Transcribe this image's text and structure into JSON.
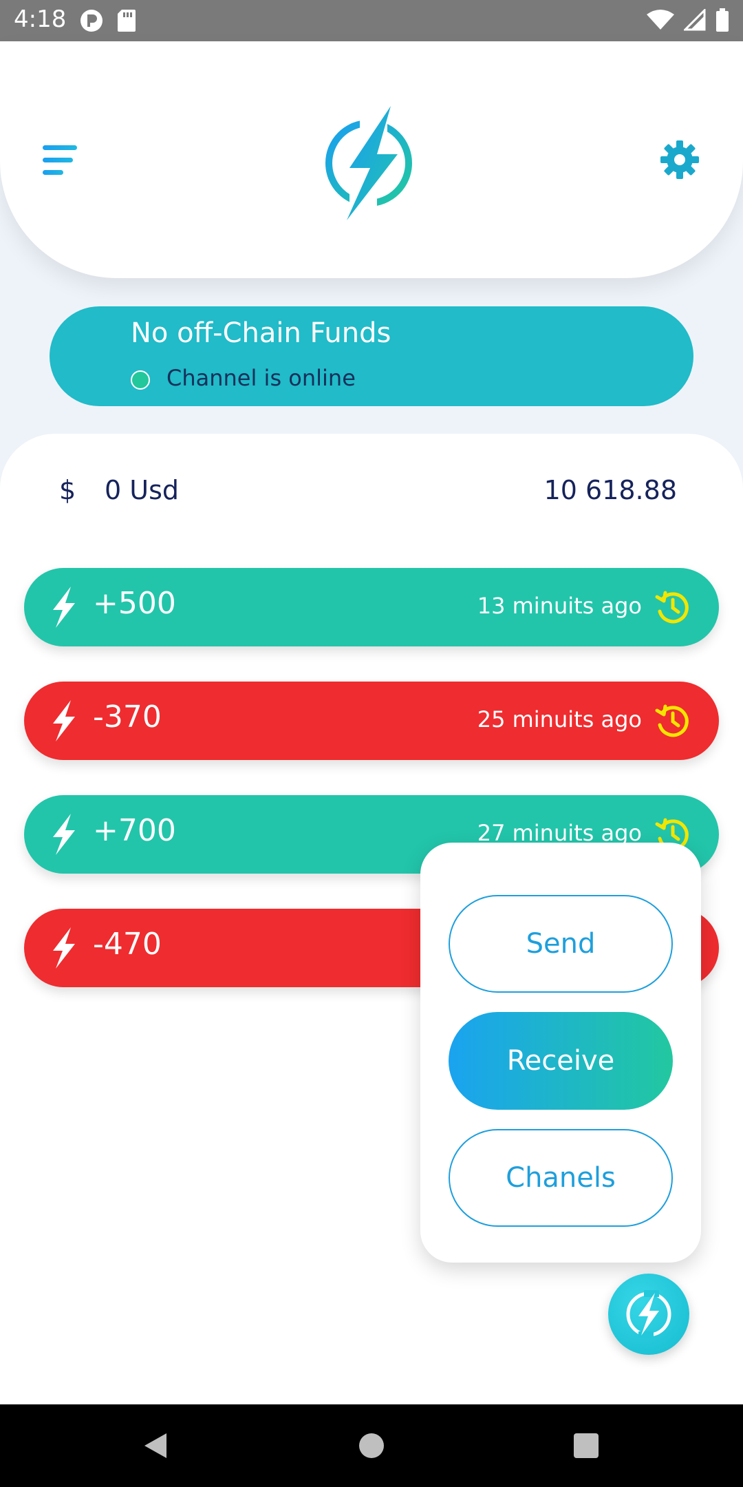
{
  "status_bar": {
    "time": "4:18"
  },
  "funds_card": {
    "title": "No off-Chain Funds",
    "status": "Channel is online"
  },
  "balance": {
    "currency_symbol": "$",
    "usd": "0 Usd",
    "value": "10 618.88"
  },
  "transactions": [
    {
      "amount": "+500",
      "time": "13 minuits ago",
      "type": "in"
    },
    {
      "amount": "-370",
      "time": "25 minuits ago",
      "type": "out"
    },
    {
      "amount": "+700",
      "time": "27 minuits ago",
      "type": "in"
    },
    {
      "amount": "-470",
      "time": "",
      "type": "out"
    }
  ],
  "action_menu": {
    "send": "Send",
    "receive": "Receive",
    "channels": "Chanels"
  },
  "colors": {
    "accent": "#21bbc9",
    "incoming": "#22c5aa",
    "outgoing": "#ef2c2f",
    "history_icon": "#f2e600",
    "text_dark": "#16235b"
  },
  "icons": {
    "menu": "menu-icon",
    "logo": "lightning-logo-icon",
    "settings": "gear-icon",
    "bolt": "bolt-icon",
    "history": "history-icon",
    "fab": "lightning-icon"
  }
}
